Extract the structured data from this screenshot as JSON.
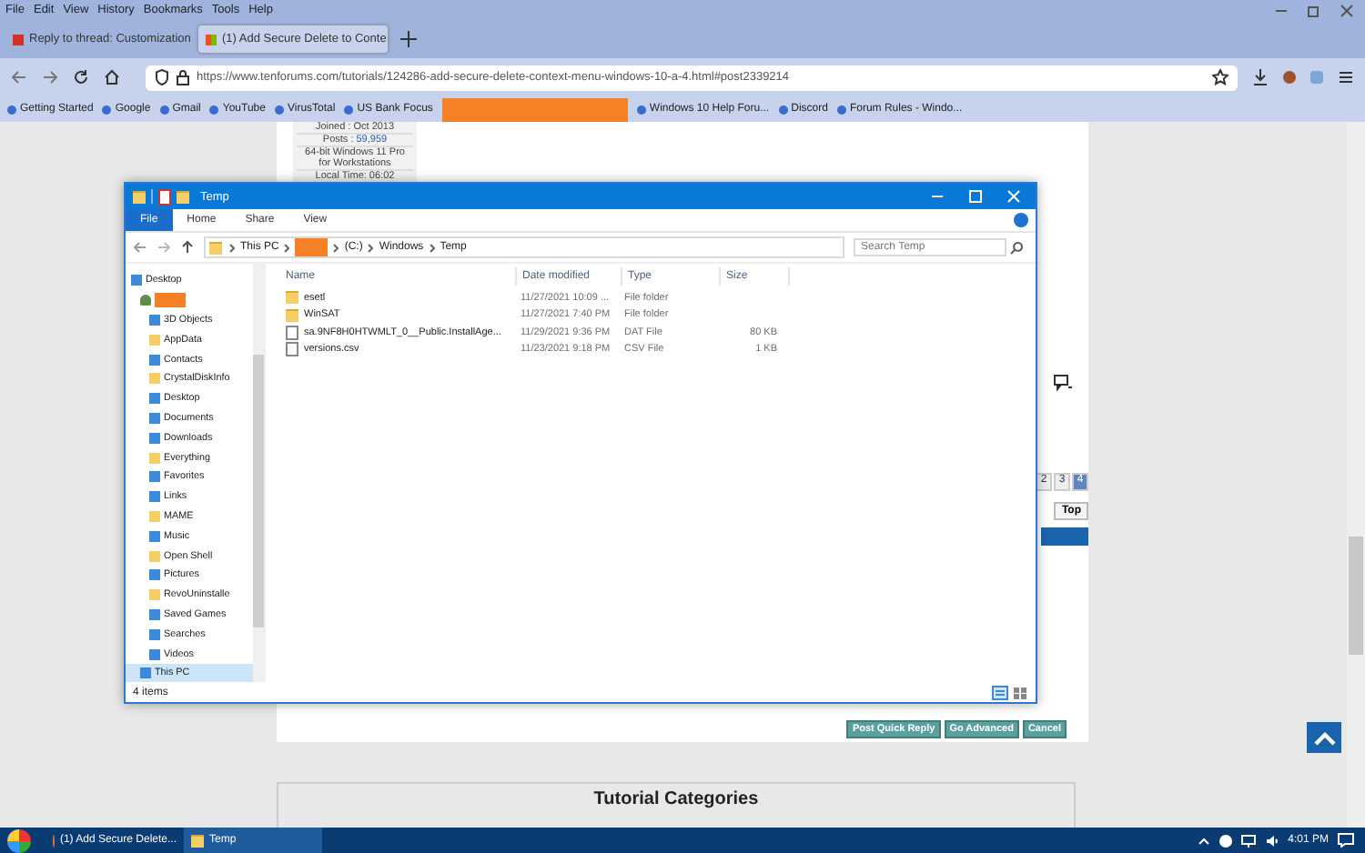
{
  "browser": {
    "menu": [
      "File",
      "Edit",
      "View",
      "History",
      "Bookmarks",
      "Tools",
      "Help"
    ],
    "tabs": [
      {
        "title": "Reply to thread: Customization",
        "selected": false
      },
      {
        "title": "(1) Add Secure Delete to Conte",
        "selected": true
      }
    ],
    "url": "https://www.tenforums.com/tutorials/124286-add-secure-delete-context-menu-windows-10-a-4.html#post2339214",
    "bookmarks": [
      {
        "kind": "link",
        "label": "Getting Started"
      },
      {
        "kind": "link",
        "label": "Google"
      },
      {
        "kind": "link",
        "label": "Gmail"
      },
      {
        "kind": "link",
        "label": "YouTube"
      },
      {
        "kind": "link",
        "label": "VirusTotal"
      },
      {
        "kind": "link",
        "label": "US Bank Focus"
      },
      {
        "kind": "redacted"
      },
      {
        "kind": "link",
        "label": "Windows 10 Help Foru..."
      },
      {
        "kind": "link",
        "label": "Discord"
      },
      {
        "kind": "link",
        "label": "Forum Rules - Windo..."
      }
    ]
  },
  "page": {
    "user_info": [
      {
        "label": "Joined : Oct 2013"
      },
      {
        "label": "Posts : ",
        "value": "59,959"
      },
      {
        "label": "64-bit Windows 11 Pro for Workstations"
      },
      {
        "label": "Local Time: 06:02"
      }
    ],
    "pages": [
      {
        "label": "2",
        "selected": false
      },
      {
        "label": "3",
        "selected": false
      },
      {
        "label": "4",
        "selected": true
      }
    ],
    "top_button": "Top",
    "buttons": [
      "Post Quick Reply",
      "Go Advanced",
      "Cancel"
    ],
    "categories_title": "Tutorial Categories"
  },
  "explorer": {
    "title": "Temp",
    "ribbon_tabs": [
      {
        "label": "File",
        "selected": true
      },
      {
        "label": "Home",
        "selected": false
      },
      {
        "label": "Share",
        "selected": false
      },
      {
        "label": "View",
        "selected": false
      }
    ],
    "breadcrumb": [
      {
        "kind": "text",
        "label": "This PC"
      },
      {
        "kind": "redacted"
      },
      {
        "kind": "text",
        "label": "(C:)"
      },
      {
        "kind": "text",
        "label": "Windows"
      },
      {
        "kind": "text",
        "label": "Temp"
      }
    ],
    "search": {
      "placeholder": "Search Temp"
    },
    "nav": [
      {
        "kind": "system",
        "label": "Desktop",
        "children": [
          {
            "kind": "redacted",
            "children": [
              {
                "kind": "system",
                "label": "3D Objects"
              },
              {
                "kind": "folder",
                "label": "AppData"
              },
              {
                "kind": "system",
                "label": "Contacts"
              },
              {
                "kind": "folder",
                "label": "CrystalDiskInfo"
              },
              {
                "kind": "system",
                "label": "Desktop"
              },
              {
                "kind": "system",
                "label": "Documents"
              },
              {
                "kind": "system",
                "label": "Downloads"
              },
              {
                "kind": "folder",
                "label": "Everything"
              },
              {
                "kind": "system",
                "label": "Favorites"
              },
              {
                "kind": "system",
                "label": "Links"
              },
              {
                "kind": "folder",
                "label": "MAME"
              },
              {
                "kind": "system",
                "label": "Music"
              },
              {
                "kind": "folder",
                "label": "Open Shell"
              },
              {
                "kind": "system",
                "label": "Pictures"
              },
              {
                "kind": "folder",
                "label": "RevoUninstalle"
              },
              {
                "kind": "system",
                "label": "Saved Games"
              },
              {
                "kind": "system",
                "label": "Searches"
              },
              {
                "kind": "system",
                "label": "Videos"
              }
            ]
          },
          {
            "kind": "system",
            "label": "This PC",
            "selected": true
          }
        ]
      }
    ],
    "columns": [
      "Name",
      "Date modified",
      "Type",
      "Size"
    ],
    "rows": [
      {
        "kind": "folder",
        "name": "esetl",
        "date": "11/27/2021 10:09 ...",
        "type": "File folder"
      },
      {
        "kind": "folder",
        "name": "WinSAT",
        "date": "11/27/2021 7:40 PM",
        "type": "File folder"
      },
      {
        "kind": "file",
        "name": "sa.9NF8H0HTWMLT_0__Public.InstallAge...",
        "date": "11/29/2021 9:36 PM",
        "type": "DAT File",
        "size": "80 KB"
      },
      {
        "kind": "file",
        "name": "versions.csv",
        "date": "11/23/2021 9:18 PM",
        "type": "CSV File",
        "size": "1 KB"
      }
    ],
    "status": "4 items"
  },
  "taskbar": {
    "items": [
      {
        "kind": "browser",
        "label": "(1) Add Secure Delete...",
        "selected": false
      },
      {
        "kind": "folder",
        "label": "Temp",
        "selected": true
      }
    ],
    "time": "4:01 PM"
  }
}
